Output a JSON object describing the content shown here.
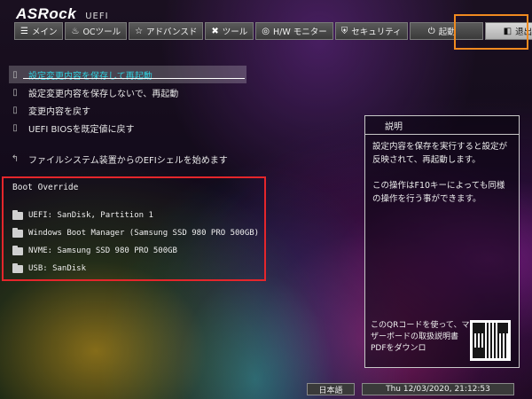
{
  "brand": {
    "logo": "ASRock",
    "subtitle": "UEFI"
  },
  "tabs": [
    {
      "label": "メイン",
      "icon": "list-icon",
      "glyph": "☰",
      "active": false
    },
    {
      "label": "OCツール",
      "icon": "flame-icon",
      "glyph": "♨",
      "active": false
    },
    {
      "label": "アドバンスド",
      "icon": "star-icon",
      "glyph": "☆",
      "active": false
    },
    {
      "label": "ツール",
      "icon": "wrench-icon",
      "glyph": "✖",
      "active": false
    },
    {
      "label": "H/W モニター",
      "icon": "monitor-icon",
      "glyph": "◎",
      "active": false
    },
    {
      "label": "セキュリティ",
      "icon": "shield-icon",
      "glyph": "⛨",
      "active": false
    },
    {
      "label": "起動",
      "icon": "power-icon",
      "glyph": "⏻",
      "active": false
    },
    {
      "label": "退出",
      "icon": "exit-icon",
      "glyph": "◧",
      "active": true
    }
  ],
  "actions": [
    {
      "label": "設定変更内容を保存して再起動",
      "selected": true
    },
    {
      "label": "設定変更内容を保存しないで、再起動",
      "selected": false
    },
    {
      "label": "変更内容を戻す",
      "selected": false
    },
    {
      "label": "UEFI BIOSを既定値に戻す",
      "selected": false
    }
  ],
  "shell_label": "ファイルシステム装置からのEFIシェルを始めます",
  "boot_override": {
    "title": "Boot Override",
    "items": [
      "UEFI: SanDisk, Partition 1",
      "Windows Boot Manager (Samsung SSD 980 PRO 500GB)",
      "NVME: Samsung SSD 980 PRO 500GB",
      "USB: SanDisk"
    ]
  },
  "help": {
    "title": "説明",
    "p1": "設定内容を保存を実行すると設定が反映されて、再起動します。",
    "p2": "この操作はF10キーによっても同様の操作を行う事ができます。",
    "qr_text": "このQRコードを使って、マザーボードの取扱説明書PDFをダウンロ"
  },
  "footer": {
    "language": "日本語",
    "datetime": "Thu 12/03/2020, 21:12:53"
  },
  "colors": {
    "highlight_text": "#2fd3e0",
    "orange_highlight": "#f08a20",
    "red_highlight": "#e5262b"
  }
}
